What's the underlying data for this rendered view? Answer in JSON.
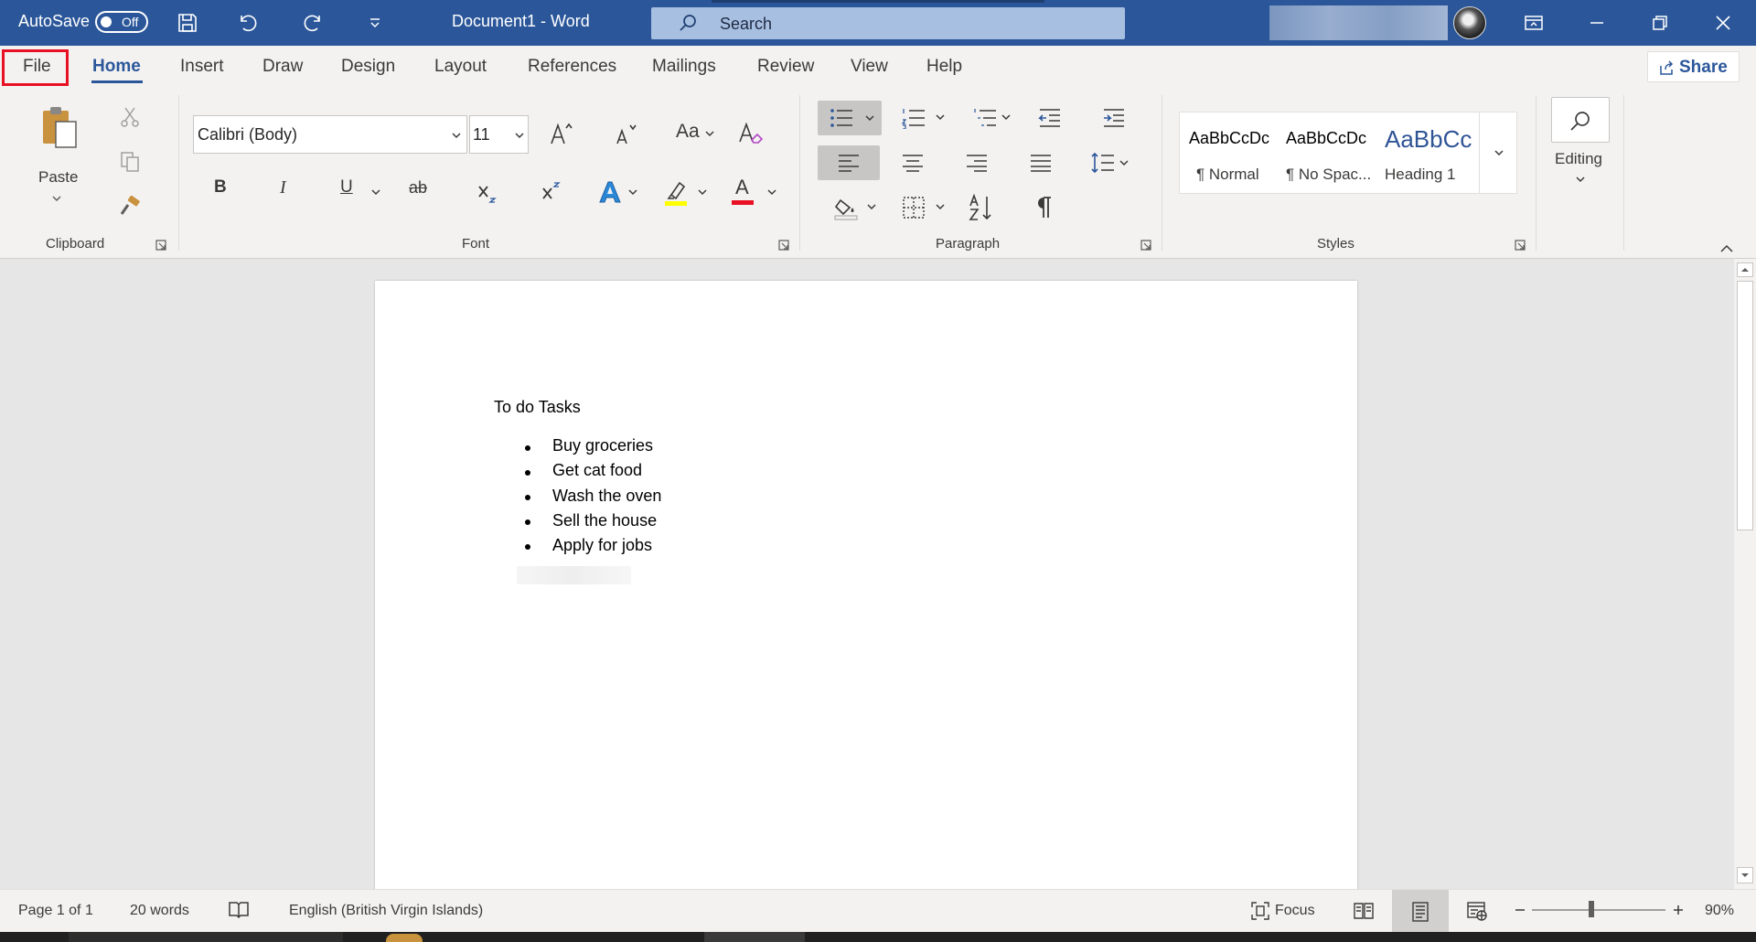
{
  "titlebar": {
    "autosave_label": "AutoSave",
    "autosave_state": "Off",
    "doc_title": "Document1  -  Word",
    "search_placeholder": "Search"
  },
  "tabs": {
    "file": "File",
    "home": "Home",
    "insert": "Insert",
    "draw": "Draw",
    "design": "Design",
    "layout": "Layout",
    "references": "References",
    "mailings": "Mailings",
    "review": "Review",
    "view": "View",
    "help": "Help",
    "share": "Share"
  },
  "ribbon": {
    "clipboard": {
      "paste_label": "Paste",
      "group_label": "Clipboard"
    },
    "font": {
      "font_name": "Calibri (Body)",
      "font_size": "11",
      "bold": "B",
      "italic": "I",
      "underline": "U",
      "strike": "ab",
      "change_case": "Aa",
      "font_color_letter": "A",
      "group_label": "Font"
    },
    "paragraph": {
      "group_label": "Paragraph"
    },
    "styles": {
      "normal_preview": "AaBbCcDc",
      "normal_label": "¶ Normal",
      "nospacing_preview": "AaBbCcDc",
      "nospacing_label": "¶ No Spac...",
      "heading1_preview": "AaBbCc",
      "heading1_label": "Heading 1",
      "group_label": "Styles"
    },
    "editing": {
      "label": "Editing"
    }
  },
  "document": {
    "heading": "To do Tasks",
    "items": [
      "Buy groceries",
      "Get cat food",
      "Wash the oven",
      "Sell the house",
      "Apply for jobs"
    ]
  },
  "statusbar": {
    "page": "Page 1 of 1",
    "words": "20 words",
    "language": "English (British Virgin Islands)",
    "focus": "Focus",
    "zoom": "90%"
  },
  "colors": {
    "title_blue": "#2b579a",
    "selected_tab_underline": "#2b579a",
    "file_highlight": "#e81123",
    "highlight_yellow": "#ffff00",
    "font_red": "#e81123"
  }
}
